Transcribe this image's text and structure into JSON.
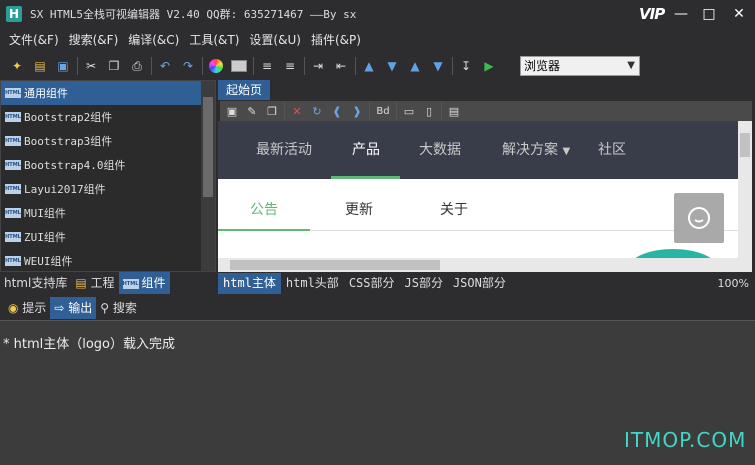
{
  "titlebar": {
    "app_icon": "H",
    "title": "SX HTML5全栈可视编辑器 V2.40 QQ群: 635271467 ——By sx",
    "vip": "VIP"
  },
  "menu": [
    "文件(&F)",
    "搜索(&F)",
    "编译(&C)",
    "工具(&T)",
    "设置(&U)",
    "插件(&P)"
  ],
  "toolbar": {
    "browser": "浏览器"
  },
  "components": [
    {
      "label": "通用组件"
    },
    {
      "label": "Bootstrap2组件"
    },
    {
      "label": "Bootstrap3组件"
    },
    {
      "label": "Bootstrap4.0组件"
    },
    {
      "label": "Layui2017组件"
    },
    {
      "label": "MUI组件"
    },
    {
      "label": "ZUI组件"
    },
    {
      "label": "WEUI组件"
    }
  ],
  "html_icon_text": "HTML",
  "left_tabs": [
    "html支持库",
    "工程",
    "组件"
  ],
  "editor": {
    "start_tab": "起始页",
    "toolbar_bd": "Bd"
  },
  "preview": {
    "nav": [
      "最新活动",
      "产品",
      "大数据",
      "解决方案",
      "社区"
    ],
    "tabs": [
      "公告",
      "更新",
      "关于"
    ]
  },
  "editor_tabs": [
    "html主体",
    "html头部",
    "CSS部分",
    "JS部分",
    "JSON部分"
  ],
  "zoom": "100%",
  "output_tabs": [
    "提示",
    "输出",
    "搜索"
  ],
  "output": {
    "line": "* html主体（logo）载入完成"
  },
  "watermark": "ITMOP.COM"
}
